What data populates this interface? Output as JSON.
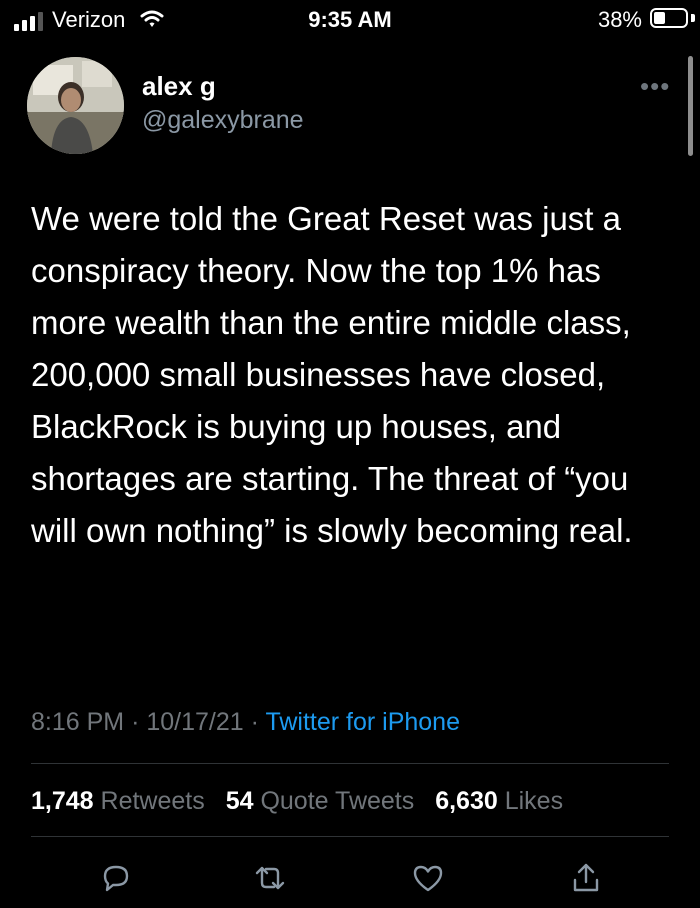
{
  "status_bar": {
    "carrier": "Verizon",
    "time": "9:35 AM",
    "battery_percent": "38%",
    "battery_level": 0.38,
    "signal_bars": 3
  },
  "tweet": {
    "author_name": "alex g",
    "author_handle": "@galexybrane",
    "text": "We were told the Great Reset was just a conspiracy theory. Now the top 1% has more wealth than the entire middle class, 200,000 small businesses have closed, BlackRock is buying up houses, and shortages are starting. The threat of “you will own nothing” is slowly becoming real.",
    "time": "8:16 PM",
    "date": "10/17/21",
    "separator": "·",
    "source": "Twitter for iPhone"
  },
  "stats": {
    "retweets_count": "1,748",
    "retweets_label": "Retweets",
    "quotes_count": "54",
    "quotes_label": "Quote Tweets",
    "likes_count": "6,630",
    "likes_label": "Likes"
  },
  "actions": [
    "reply-icon",
    "retweet-icon",
    "like-icon",
    "share-icon"
  ],
  "colors": {
    "background": "#000000",
    "text": "#ffffff",
    "secondary_text": "#71767b",
    "link": "#1d9bf0",
    "divider": "#2f3336"
  }
}
